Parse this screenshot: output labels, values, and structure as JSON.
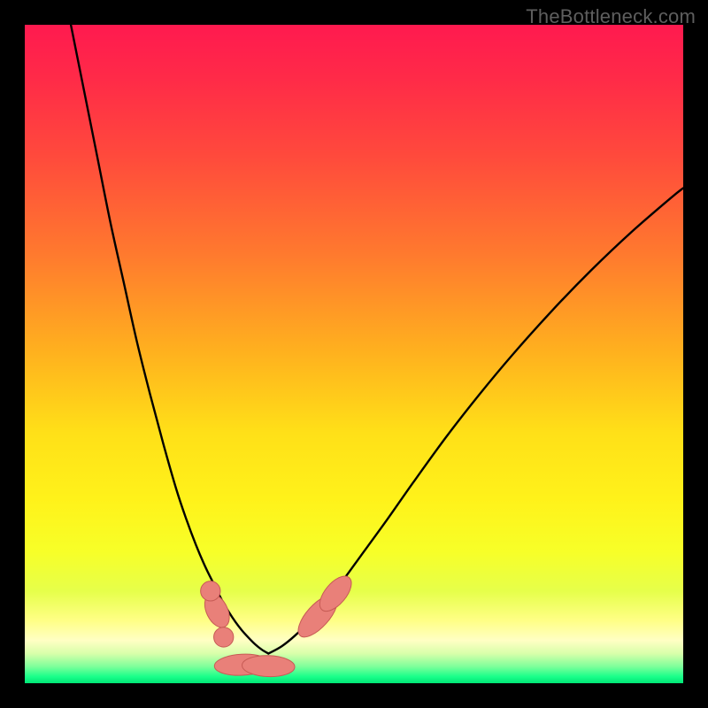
{
  "watermark": "TheBottleneck.com",
  "colors": {
    "frame": "#000000",
    "gradient_stops": [
      {
        "offset": 0.0,
        "color": "#ff1a4f"
      },
      {
        "offset": 0.08,
        "color": "#ff2a48"
      },
      {
        "offset": 0.2,
        "color": "#ff4a3c"
      },
      {
        "offset": 0.35,
        "color": "#ff7a2e"
      },
      {
        "offset": 0.5,
        "color": "#ffb21e"
      },
      {
        "offset": 0.62,
        "color": "#ffe018"
      },
      {
        "offset": 0.72,
        "color": "#fff21a"
      },
      {
        "offset": 0.8,
        "color": "#f7ff28"
      },
      {
        "offset": 0.86,
        "color": "#e6ff4a"
      },
      {
        "offset": 0.905,
        "color": "#ffff86"
      },
      {
        "offset": 0.935,
        "color": "#ffffc4"
      },
      {
        "offset": 0.955,
        "color": "#d8ffaa"
      },
      {
        "offset": 0.975,
        "color": "#7cff9a"
      },
      {
        "offset": 0.99,
        "color": "#1aff8a"
      },
      {
        "offset": 1.0,
        "color": "#00e676"
      }
    ],
    "curve": "#000000",
    "marker_fill": "#e98079",
    "marker_stroke": "#c75b55"
  },
  "chart_data": {
    "type": "line",
    "title": "",
    "xlabel": "",
    "ylabel": "",
    "xlim": [
      0,
      100
    ],
    "ylim": [
      0,
      100
    ],
    "grid": false,
    "series": [
      {
        "name": "curve-left",
        "x": [
          7,
          9,
          11,
          13,
          15,
          17,
          19,
          21,
          23,
          24.5,
          26,
          27.5,
          29,
          30,
          31,
          32,
          33,
          34,
          35,
          36,
          37
        ],
        "values": [
          100,
          90,
          80,
          70,
          61,
          52,
          44,
          36.5,
          29.5,
          25,
          21,
          17.5,
          14.5,
          12.5,
          10.8,
          9.3,
          8,
          6.9,
          5.9,
          5.1,
          4.5
        ]
      },
      {
        "name": "curve-right",
        "x": [
          37,
          39,
          41,
          43,
          45,
          48,
          51,
          55,
          59,
          64,
          69,
          74,
          80,
          86,
          92,
          98,
          100
        ],
        "values": [
          4.5,
          5.6,
          7.2,
          9.2,
          11.5,
          15.2,
          19.3,
          24.8,
          30.5,
          37.4,
          43.8,
          49.8,
          56.5,
          62.7,
          68.4,
          73.6,
          75.2
        ]
      }
    ],
    "markers": [
      {
        "shape": "pill",
        "cx": 33.0,
        "cy": 2.8,
        "rx": 4.2,
        "ry": 1.6,
        "rot": 3
      },
      {
        "shape": "pill",
        "cx": 37.0,
        "cy": 2.6,
        "rx": 4.0,
        "ry": 1.6,
        "rot": -2
      },
      {
        "shape": "pill",
        "cx": 44.5,
        "cy": 10.2,
        "rx": 4.0,
        "ry": 1.7,
        "rot": 48
      },
      {
        "shape": "pill",
        "cx": 47.2,
        "cy": 13.6,
        "rx": 3.2,
        "ry": 1.6,
        "rot": 50
      },
      {
        "shape": "pill",
        "cx": 29.2,
        "cy": 11.0,
        "rx": 2.7,
        "ry": 1.6,
        "rot": -64
      },
      {
        "shape": "circle",
        "cx": 28.2,
        "cy": 14.0,
        "r": 1.5
      },
      {
        "shape": "circle",
        "cx": 30.2,
        "cy": 7.0,
        "r": 1.5
      }
    ]
  }
}
